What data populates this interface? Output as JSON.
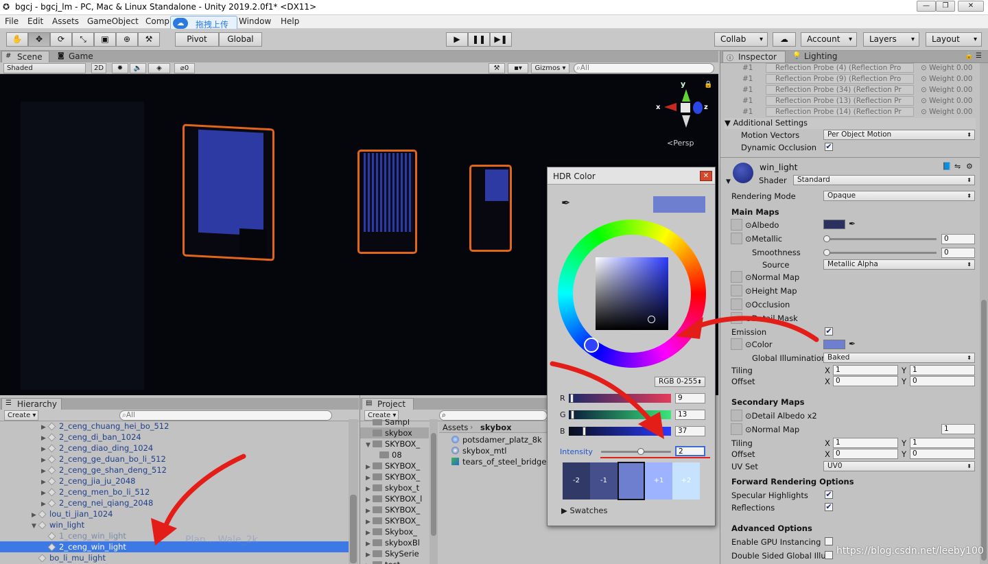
{
  "title": "bgcj - bgcj_lm - PC, Mac & Linux Standalone - Unity 2019.2.0f1* <DX11>",
  "menu": [
    "File",
    "Edit",
    "Assets",
    "GameObject",
    "Comp",
    "Window",
    "Help"
  ],
  "upload_label": "拖拽上传",
  "toolbar": {
    "pivot": "Pivot",
    "global": "Global",
    "collab": "Collab",
    "account": "Account",
    "layers": "Layers",
    "layout": "Layout"
  },
  "scene": {
    "tab_scene": "Scene",
    "tab_game": "Game",
    "shading": "Shaded",
    "mode2d": "2D",
    "hidden_count": "0",
    "gizmos": "Gizmos",
    "search_placeholder": "All",
    "persp": "Persp",
    "axis_x": "x",
    "axis_y": "y",
    "axis_z": "z"
  },
  "hierarchy": {
    "tab": "Hierarchy",
    "create": "Create",
    "search_placeholder": "All",
    "rows": [
      {
        "label": "2_ceng_chuang_hei_bo_512",
        "indent": 1,
        "arrow": "▶"
      },
      {
        "label": "2_ceng_di_ban_1024",
        "indent": 1,
        "arrow": "▶"
      },
      {
        "label": "2_ceng_diao_ding_1024",
        "indent": 1,
        "arrow": "▶"
      },
      {
        "label": "2_ceng_ge_duan_bo_li_512",
        "indent": 1,
        "arrow": "▶"
      },
      {
        "label": "2_ceng_ge_shan_deng_512",
        "indent": 1,
        "arrow": "▶"
      },
      {
        "label": "2_ceng_jia_ju_2048",
        "indent": 1,
        "arrow": "▶"
      },
      {
        "label": "2_ceng_men_bo_li_512",
        "indent": 1,
        "arrow": "▶"
      },
      {
        "label": "2_ceng_nei_qiang_2048",
        "indent": 1,
        "arrow": "▶"
      },
      {
        "label": "lou_ti_jian_1024",
        "indent": 0,
        "arrow": "▶"
      },
      {
        "label": "win_light",
        "indent": 0,
        "arrow": "▼"
      },
      {
        "label": "1_ceng_win_light",
        "indent": 1,
        "arrow": "",
        "dim": true
      },
      {
        "label": "2_ceng_win_light",
        "indent": 1,
        "arrow": "",
        "selected": true
      },
      {
        "label": "bo_li_mu_light",
        "indent": 0,
        "arrow": ""
      }
    ]
  },
  "project": {
    "tab": "Project",
    "create": "Create",
    "folders": [
      "Sampl",
      "skybox",
      "SKYBOX_",
      "08",
      "SKYBOX_",
      "SKYBOX_",
      "skybox_t",
      "SKYBOX_l",
      "SKYBOX_",
      "SKYBOX_",
      "Skybox_",
      "skyboxBl",
      "SkySerie",
      "test"
    ],
    "breadcrumb_root": "Assets",
    "breadcrumb_current": "skybox",
    "assets": [
      "potsdamer_platz_8k",
      "skybox_mtl",
      "tears_of_steel_bridge"
    ]
  },
  "watermark_ghost": "Plan... Wale_2k",
  "inspector": {
    "tab": "Inspector",
    "tab2": "Lighting",
    "probes": [
      {
        "idx": "#1",
        "name": "Reflection Probe (4) (Reflection Pro",
        "weight": "Weight 0.00"
      },
      {
        "idx": "#1",
        "name": "Reflection Probe (9) (Reflection Pro",
        "weight": "Weight 0.00"
      },
      {
        "idx": "#1",
        "name": "Reflection Probe (34) (Reflection Pr",
        "weight": "Weight 0.00"
      },
      {
        "idx": "#1",
        "name": "Reflection Probe (13) (Reflection Pr",
        "weight": "Weight 0.00"
      },
      {
        "idx": "#1",
        "name": "Reflection Probe (14) (Reflection Pr",
        "weight": "Weight 0.00"
      }
    ],
    "additional_settings": "Additional Settings",
    "motion_vectors_label": "Motion Vectors",
    "motion_vectors_value": "Per Object Motion",
    "dynamic_occlusion_label": "Dynamic Occlusion",
    "material_name": "win_light",
    "shader_label": "Shader",
    "shader_value": "Standard",
    "rendering_mode_label": "Rendering Mode",
    "rendering_mode_value": "Opaque",
    "main_maps": "Main Maps",
    "albedo": "Albedo",
    "metallic": "Metallic",
    "metallic_value": "0",
    "smoothness": "Smoothness",
    "smoothness_value": "0",
    "source": "Source",
    "source_value": "Metallic Alpha",
    "normal_map": "Normal Map",
    "height_map": "Height Map",
    "occlusion": "Occlusion",
    "detail_mask": "Detail Mask",
    "emission": "Emission",
    "color": "Color",
    "gi_label": "Global Illumination",
    "gi_value": "Baked",
    "tiling": "Tiling",
    "offset": "Offset",
    "x": "X",
    "y": "Y",
    "tiling_x": "1",
    "tiling_y": "1",
    "offset_x": "0",
    "offset_y": "0",
    "secondary_maps": "Secondary Maps",
    "detail_albedo": "Detail Albedo x2",
    "sec_normal_map": "Normal Map",
    "sec_normal_value": "1",
    "sec_tiling_x": "1",
    "sec_tiling_y": "1",
    "sec_offset_x": "0",
    "sec_offset_y": "0",
    "uv_set_label": "UV Set",
    "uv_set_value": "UV0",
    "forward_options": "Forward Rendering Options",
    "specular": "Specular Highlights",
    "reflections": "Reflections",
    "advanced": "Advanced Options",
    "gpu_instancing": "Enable GPU Instancing",
    "double_sided": "Double Sided Global Illu"
  },
  "hdr": {
    "title": "HDR Color",
    "mode": "RGB 0-255",
    "r_label": "R",
    "r_value": "9",
    "g_label": "G",
    "g_value": "13",
    "b_label": "B",
    "b_value": "37",
    "intensity_label": "Intensity",
    "intensity_value": "2",
    "swatches": [
      "-2",
      "-1",
      "",
      "+1",
      "+2"
    ],
    "swatches_label": "Swatches",
    "color_hex": "#6f7fcf"
  },
  "watermark": "https://blog.csdn.net/leeby100"
}
